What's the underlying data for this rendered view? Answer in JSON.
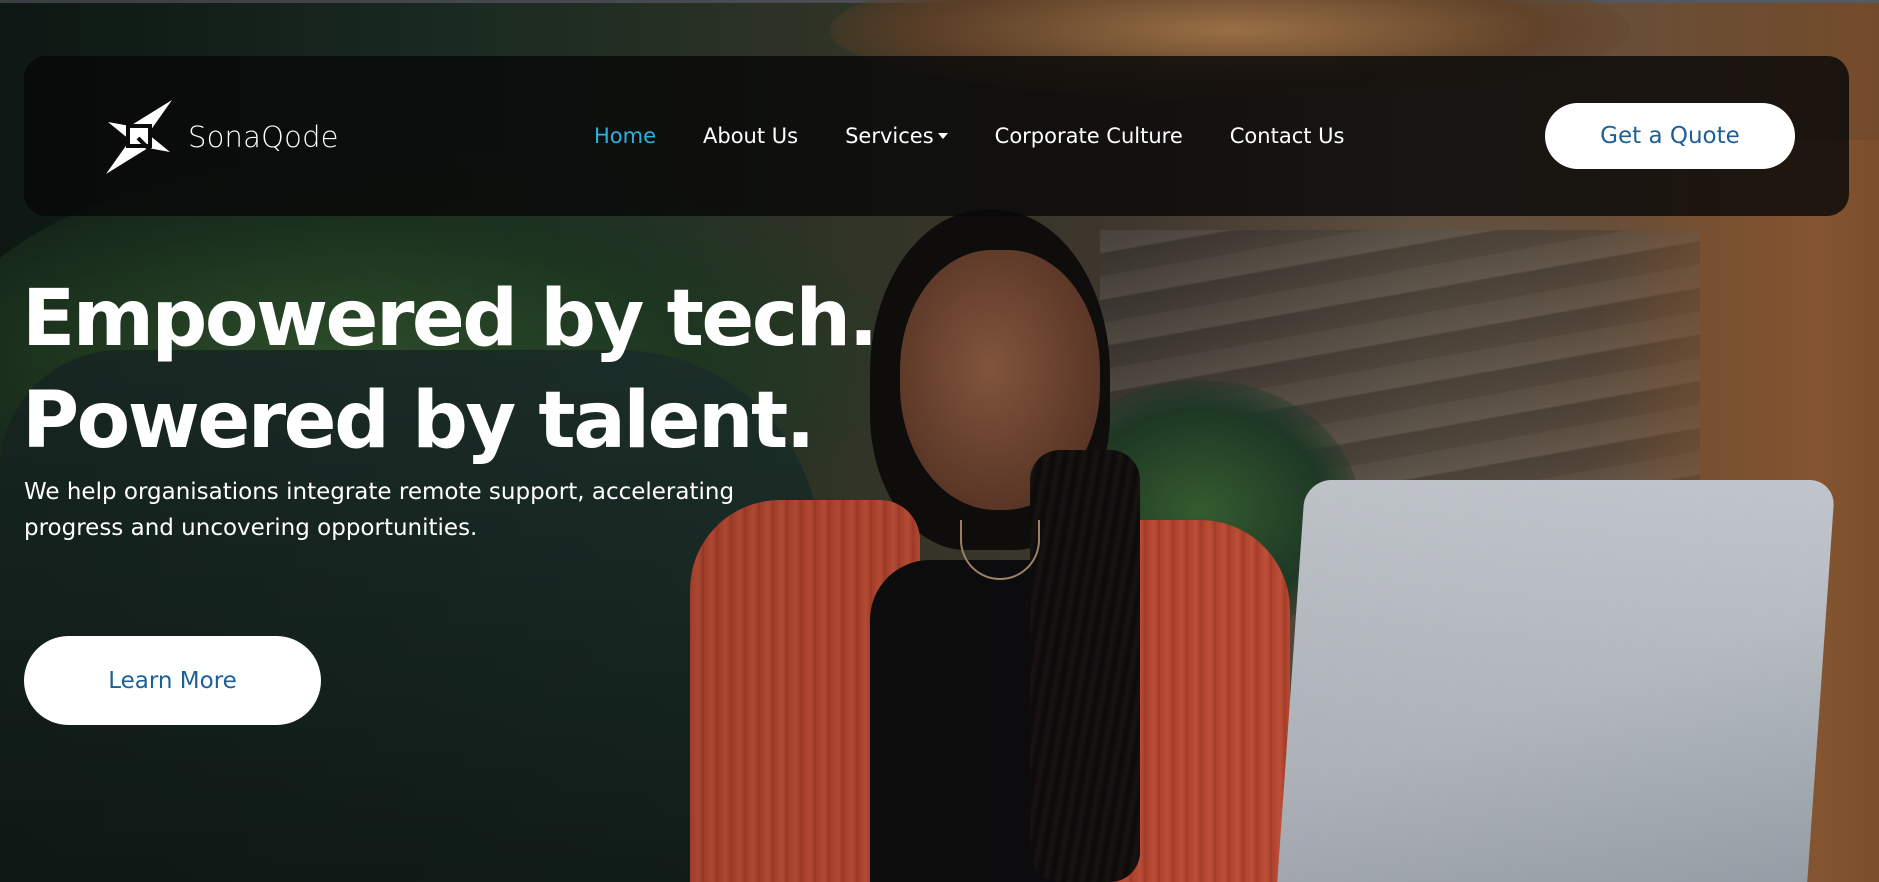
{
  "brand": {
    "name": "SonaQode",
    "logo_icon": "lightning-q-logo-icon"
  },
  "nav": {
    "items": [
      {
        "label": "Home",
        "active": true
      },
      {
        "label": "About Us",
        "active": false
      },
      {
        "label": "Services",
        "active": false,
        "has_dropdown": true,
        "dropdown_icon": "caret-down-icon"
      },
      {
        "label": "Corporate Culture",
        "active": false
      },
      {
        "label": "Contact Us",
        "active": false
      }
    ],
    "cta_label": "Get a Quote"
  },
  "hero": {
    "headline_line1": "Empowered by tech.",
    "headline_line2": "Powered by talent.",
    "subtext_line1": "We help organisations integrate remote support, accelerating",
    "subtext_line2": "progress and uncovering opportunities.",
    "button_label": "Learn More"
  },
  "colors": {
    "nav_active": "#2cb2e0",
    "button_text": "#1d5f96",
    "button_bg": "#ffffff",
    "navbar_bg": "#080808"
  }
}
